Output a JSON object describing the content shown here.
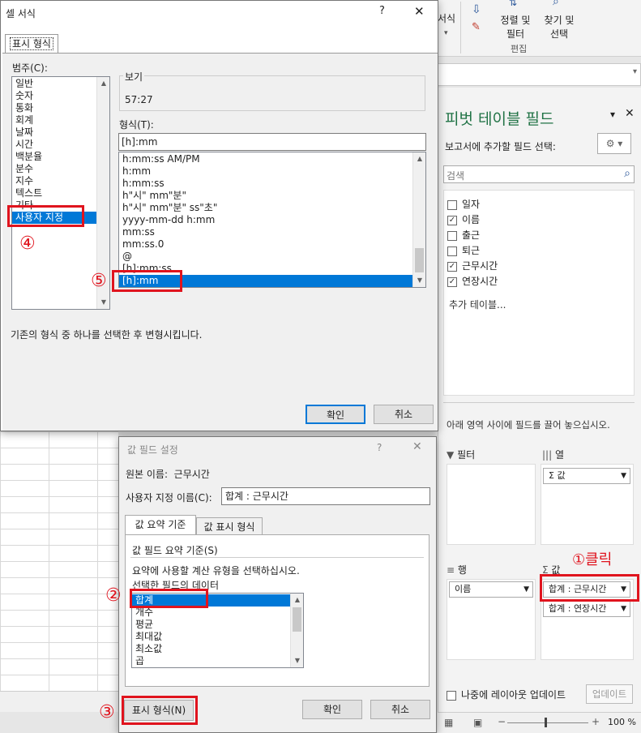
{
  "ribbon": {
    "format_label": "서식",
    "sort_filter_l1": "정렬 및",
    "sort_filter_l2": "필터",
    "find_select_l1": "찾기 및",
    "find_select_l2": "선택",
    "edit_group": "편집"
  },
  "pivot": {
    "title": "피벗 테이블 필드",
    "choose_label": "보고서에 추가할 필드 선택:",
    "search_placeholder": "검색",
    "fields": [
      {
        "label": "일자",
        "checked": false
      },
      {
        "label": "이름",
        "checked": true
      },
      {
        "label": "출근",
        "checked": false
      },
      {
        "label": "퇴근",
        "checked": false
      },
      {
        "label": "근무시간",
        "checked": true
      },
      {
        "label": "연장시간",
        "checked": true
      }
    ],
    "more_tables": "추가 테이블...",
    "drag_hint": "아래 영역 사이에 필드를 끌어 놓으십시오.",
    "filter_label": "필터",
    "columns_label": "열",
    "columns_value": "Σ 값",
    "rows_label": "행",
    "rows_value": "이름",
    "values_label": "값",
    "values_item1": "합계 : 근무시간",
    "values_item2": "합계 : 연장시간",
    "defer_label": "나중에 레이아웃 업데이트",
    "update_button": "업데이트"
  },
  "status": {
    "zoom": "100 %"
  },
  "format_dialog": {
    "title": "셀 서식",
    "help": "?",
    "tab": "표시 형식",
    "category_label": "범주(C):",
    "categories": [
      "일반",
      "숫자",
      "통화",
      "회계",
      "날짜",
      "시간",
      "백분율",
      "분수",
      "지수",
      "텍스트",
      "기타",
      "사용자 지정"
    ],
    "sample_label": "보기",
    "sample_value": "57:27",
    "type_label": "형식(T):",
    "type_value": "[h]:mm",
    "types": [
      "h:mm:ss AM/PM",
      "h:mm",
      "h:mm:ss",
      "h\"시\" mm\"분\"",
      "h\"시\" mm\"분\" ss\"초\"",
      "yyyy-mm-dd h:mm",
      "mm:ss",
      "mm:ss.0",
      "@",
      "[h]:mm:ss",
      "[h]:mm"
    ],
    "hint": "기존의 형식 중 하나를 선택한 후 변형시킵니다.",
    "ok": "확인",
    "cancel": "취소"
  },
  "value_dialog": {
    "title": "값 필드 설정",
    "help": "?",
    "source_label": "원본 이름:",
    "source_value": "근무시간",
    "custom_label": "사용자 지정 이름(C):",
    "custom_value": "합계 : 근무시간",
    "tab1": "값 요약 기준",
    "tab2": "값 표시 형식",
    "summarize_label": "값 필드 요약 기준(S)",
    "calc_hint": "요약에 사용할 계산 유형을 선택하십시오.",
    "data_label": "선택한 필드의 데이터",
    "functions": [
      "합계",
      "개수",
      "평균",
      "최대값",
      "최소값",
      "곱"
    ],
    "number_format": "표시 형식(N)",
    "ok": "확인",
    "cancel": "취소"
  },
  "annotations": {
    "n1": "①클릭",
    "n2": "②",
    "n3": "③",
    "n4": "④",
    "n5": "⑤"
  }
}
